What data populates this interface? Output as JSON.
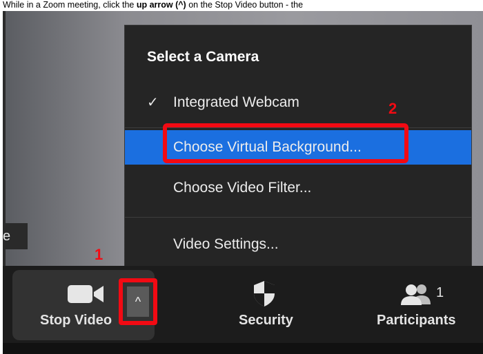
{
  "caption": {
    "part1": "While in a Zoom meeting, click the ",
    "bold": "up arrow (^)",
    "part2": " on the Stop Video button - the"
  },
  "menu": {
    "title": "Select a Camera",
    "camera_item": "Integrated Webcam",
    "virtual_bg": "Choose Virtual Background...",
    "video_filter": "Choose Video Filter...",
    "video_settings": "Video Settings..."
  },
  "annotations": {
    "step1": "1",
    "step2": "2",
    "accent": "#f20a13"
  },
  "toolbar": {
    "stop_video": "Stop Video",
    "security": "Security",
    "participants": "Participants",
    "participants_count": "1",
    "arrow": "^"
  },
  "edge_label": "e",
  "colors": {
    "highlight": "#1b6fe0",
    "menu_bg": "#252525",
    "toolbar_bg": "#1c1c1c"
  }
}
